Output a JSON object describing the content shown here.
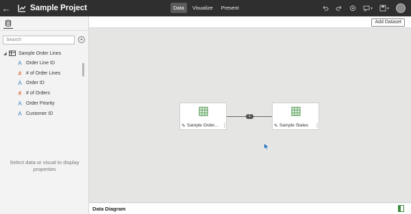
{
  "topbar": {
    "project_title": "Sample Project",
    "tabs": [
      {
        "label": "Data",
        "active": true
      },
      {
        "label": "Visualize",
        "active": false
      },
      {
        "label": "Present",
        "active": false
      }
    ],
    "tool_icons": [
      "undo-icon",
      "redo-icon",
      "data-activity-icon",
      "comment-icon",
      "save-icon",
      "user-avatar"
    ]
  },
  "left_panel": {
    "search_placeholder": "Search",
    "dataset": {
      "name": "Sample Order Lines",
      "columns": [
        {
          "label": "Order Line ID",
          "type": "attribute"
        },
        {
          "label": "# of Order Lines",
          "type": "measure"
        },
        {
          "label": "Order ID",
          "type": "attribute"
        },
        {
          "label": "# of Orders",
          "type": "measure"
        },
        {
          "label": "Order Priority",
          "type": "attribute"
        },
        {
          "label": "Customer ID",
          "type": "attribute"
        }
      ]
    },
    "properties_message": "Select data or visual to display properties"
  },
  "main": {
    "add_dataset_label": "Add Dataset",
    "cards": [
      {
        "name": "Sample Order..."
      },
      {
        "name": "Sample States"
      }
    ],
    "join_count": "1",
    "bottom_title": "Data Diagram"
  },
  "colors": {
    "topbar_bg": "#2f2f2f",
    "canvas_bg": "#e5e5e3",
    "attribute": "#3b7fc4",
    "measure": "#d9652c",
    "dataset_icon": "#3a8a3a",
    "cursor": "#1f6fb5"
  }
}
